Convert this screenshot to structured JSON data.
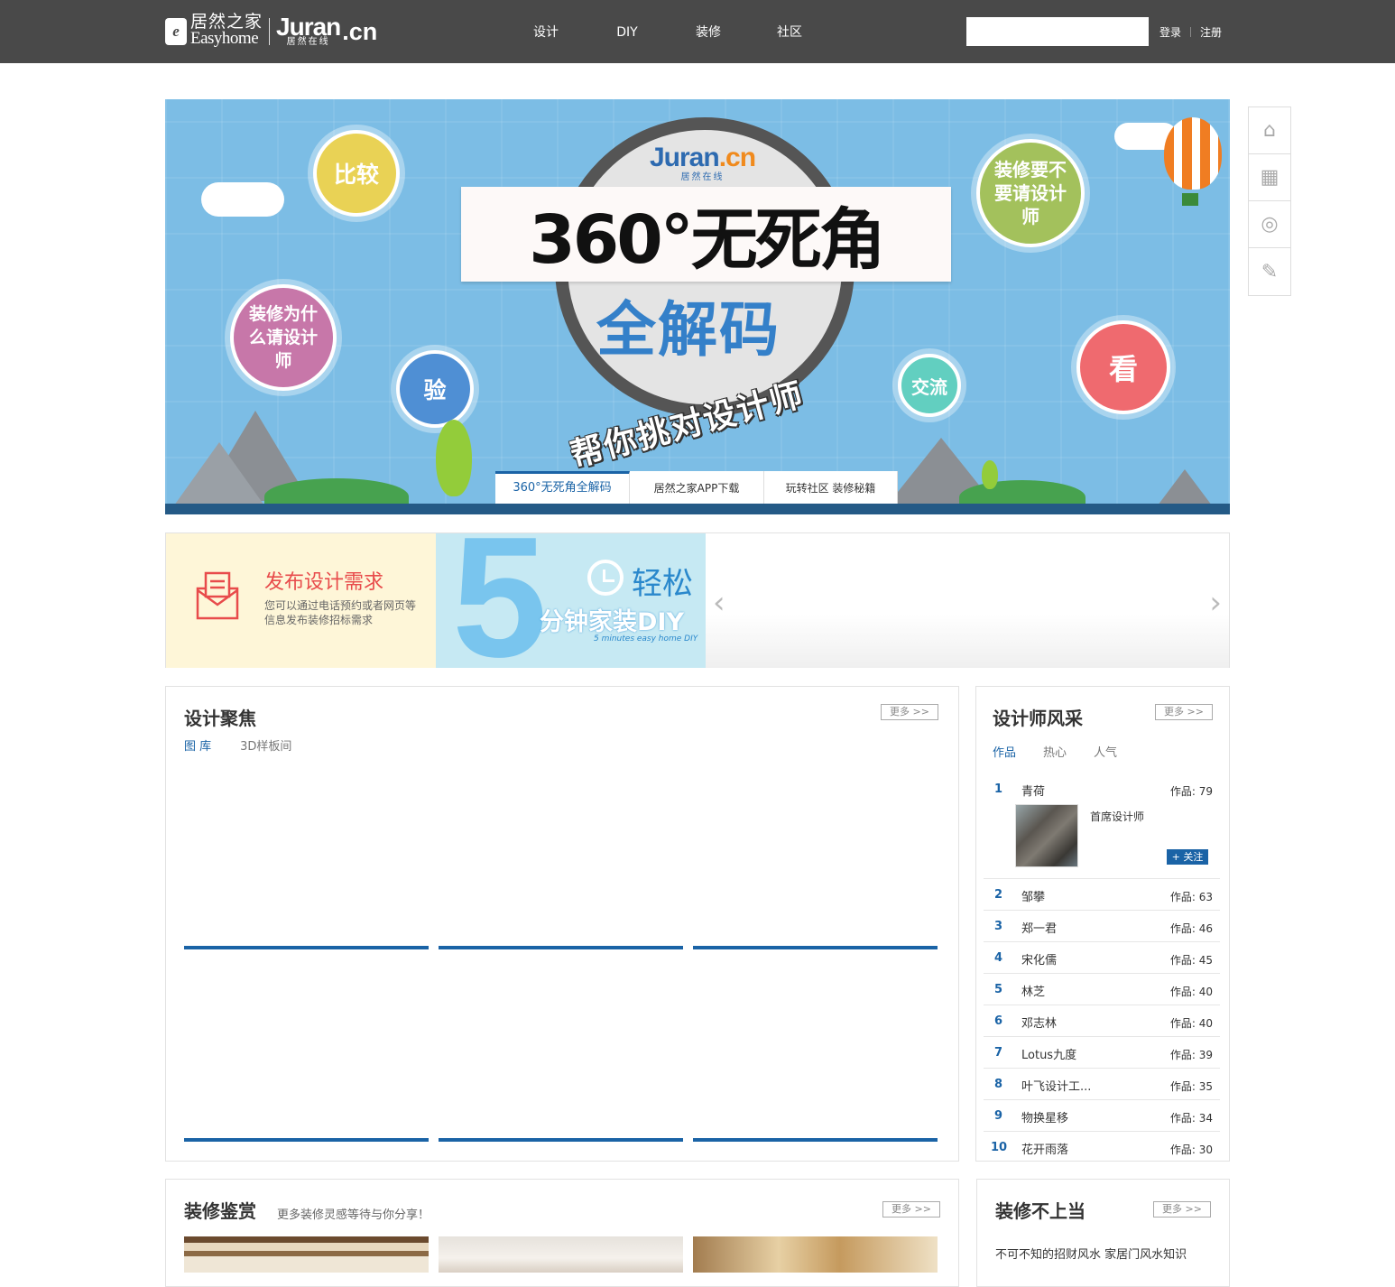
{
  "header": {
    "logo": {
      "cn": "居然之家",
      "en": "Easyhome",
      "juran": "Juran",
      "juran_sub": "居然在线",
      "cn_mark": ".cn"
    },
    "nav": [
      {
        "label": "设计"
      },
      {
        "label": "DIY"
      },
      {
        "label": "装修"
      },
      {
        "label": "社区"
      }
    ],
    "search_value": "",
    "login": "登录",
    "register": "注册"
  },
  "hero": {
    "brand": "Juran",
    "brand_cn": ".cn",
    "brand_sub": "居然在线",
    "title": "360°无死角",
    "subtitle": "全解码",
    "slogan": "帮你挑对设计师",
    "bubbles": [
      "比较",
      "装修为什么请设计师",
      "验",
      "装修要不要请设计师",
      "交流",
      "看"
    ],
    "tabs": [
      {
        "label": "360°无死角全解码"
      },
      {
        "label": "居然之家APP下载"
      },
      {
        "label": "玩转社区 装修秘籍"
      }
    ]
  },
  "promo": {
    "publish_title": "发布设计需求",
    "publish_desc": "您可以通过电话预约或者网页等信息发布装修招标需求",
    "diy_number": "5",
    "diy_easy": "轻松",
    "diy_title": "分钟家装DIY",
    "diy_en": "5 minutes easy home DIY"
  },
  "design_focus": {
    "title": "设计聚焦",
    "more": "更多 >>",
    "tabs": [
      {
        "label": "图 库"
      },
      {
        "label": "3D样板间"
      }
    ]
  },
  "designers": {
    "title": "设计师风采",
    "more": "更多 >>",
    "tabs": [
      {
        "label": "作品"
      },
      {
        "label": "热心"
      },
      {
        "label": "人气"
      }
    ],
    "top": {
      "rank": "1",
      "name": "青荷",
      "works": "作品: 79",
      "role": "首席设计师",
      "follow": "+ 关注"
    },
    "list": [
      {
        "rank": "2",
        "name": "邹攀",
        "works": "作品: 63"
      },
      {
        "rank": "3",
        "name": "郑一君",
        "works": "作品: 46"
      },
      {
        "rank": "4",
        "name": "宋化儒",
        "works": "作品: 45"
      },
      {
        "rank": "5",
        "name": "林芝",
        "works": "作品: 40"
      },
      {
        "rank": "6",
        "name": "邓志林",
        "works": "作品: 40"
      },
      {
        "rank": "7",
        "name": "Lotus九度",
        "works": "作品: 39"
      },
      {
        "rank": "8",
        "name": "叶飞设计工...",
        "works": "作品: 35"
      },
      {
        "rank": "9",
        "name": "物换星移",
        "works": "作品: 34"
      },
      {
        "rank": "10",
        "name": "花开雨落",
        "works": "作品: 30"
      }
    ]
  },
  "appreciation": {
    "title": "装修鉴赏",
    "subtitle": "更多装修灵感等待与你分享！",
    "more": "更多 >>"
  },
  "mistakes": {
    "title": "装修不上当",
    "more": "更多 >>",
    "first_item": "不可不知的招财风水 家居门风水知识"
  },
  "colors": {
    "accent": "#1a63a6",
    "topbar": "#494949",
    "hero_bg": "#7cbde5"
  }
}
